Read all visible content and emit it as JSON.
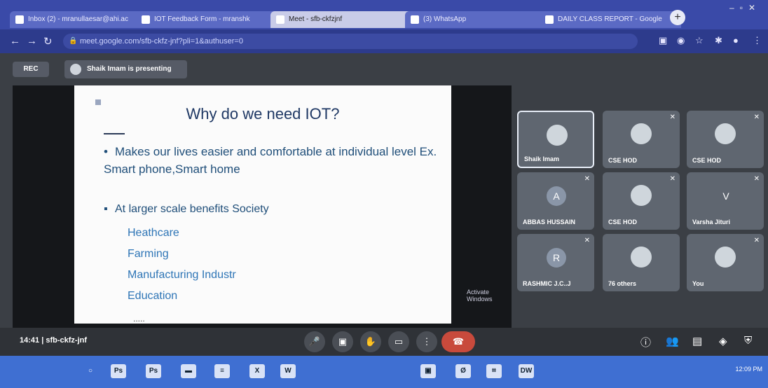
{
  "browser": {
    "tabs": [
      {
        "label": "Inbox (2) - mranullaesar@ahi.ac",
        "active": false
      },
      {
        "label": "IOT Feedback Form - mranshk",
        "active": false
      },
      {
        "label": "Meet - sfb-ckfzjnf",
        "active": true
      },
      {
        "label": "(3) WhatsApp",
        "active": false
      },
      {
        "label": "DAILY CLASS REPORT - Google",
        "active": false
      }
    ],
    "url": "meet.google.com/sfb-ckfz-jnf?pli=1&authuser=0",
    "new_tab": "+"
  },
  "meet": {
    "rec_label": "REC",
    "presenting_label": "Shaik Imam is presenting",
    "meeting_code": "14:41  |  sfb-ckfz-jnf",
    "windows_watermark": "Activate Windows"
  },
  "slide": {
    "title": "Why do we need IOT?",
    "bullet1": "Makes our lives easier and comfortable at individual level  Ex. Smart phone,Smart home",
    "bullet2": "At larger scale benefits Society",
    "items": [
      "Heathcare",
      "Farming",
      "Manufacturing Industr",
      "Education"
    ],
    "ellipsis": "....."
  },
  "participants": [
    {
      "name": "Shaik Imam",
      "initial": "",
      "type": "photo",
      "active": true
    },
    {
      "name": "CSE HOD",
      "initial": "",
      "type": "photo",
      "active": false
    },
    {
      "name": "CSE HOD",
      "initial": "",
      "type": "photo",
      "active": false
    },
    {
      "name": "ABBAS HUSSAIN",
      "initial": "A",
      "type": "initial",
      "active": false
    },
    {
      "name": "CSE HOD",
      "initial": "",
      "type": "photo",
      "active": false
    },
    {
      "name": "Varsha Jituri",
      "initial": "V",
      "type": "initial",
      "active": false
    },
    {
      "name": "RASHMIC J.C..J",
      "initial": "R",
      "type": "initial",
      "active": false
    },
    {
      "name": "76 others",
      "initial": "",
      "type": "group",
      "active": false
    },
    {
      "name": "You",
      "initial": "",
      "type": "photo",
      "active": false
    }
  ],
  "taskbar": {
    "items": [
      "Ps",
      "Ps",
      "▬",
      "≡",
      "X",
      "W",
      "▣",
      "Ø",
      "⌗",
      "DW"
    ],
    "clock": "12:09 PM"
  },
  "colors": {
    "tab_strip": "#3a4aa8",
    "meet_bg": "#3b3f45",
    "end_call": "#c84a3c",
    "taskbar": "#3f6fd2"
  }
}
